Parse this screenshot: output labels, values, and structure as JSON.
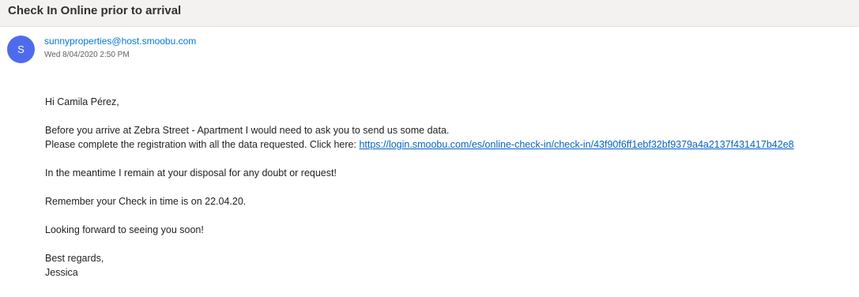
{
  "email": {
    "subject": "Check In Online prior to arrival",
    "sender": {
      "avatar_initial": "S",
      "avatar_color": "#4f6bed",
      "address": "sunnyproperties@host.smoobu.com",
      "date": "Wed 8/04/2020 2:50 PM"
    },
    "body": {
      "greeting": "Hi Camila Pérez,",
      "line1": "Before you arrive at Zebra Street - Apartment I would need to ask you to send us some data.",
      "line2_prefix": "Please complete the registration with all the data requested. Click here: ",
      "link": "https://login.smoobu.com/es/online-check-in/check-in/43f90f6ff1ebf32bf9379a4a2137f431417b42e8",
      "meantime": "In the meantime I remain at your disposal for any doubt or request!",
      "remember": "Remember your Check in time is on 22.04.20.",
      "looking_forward": "Looking forward to seeing you soon!",
      "regards": "Best regards,",
      "signature": "Jessica"
    }
  }
}
